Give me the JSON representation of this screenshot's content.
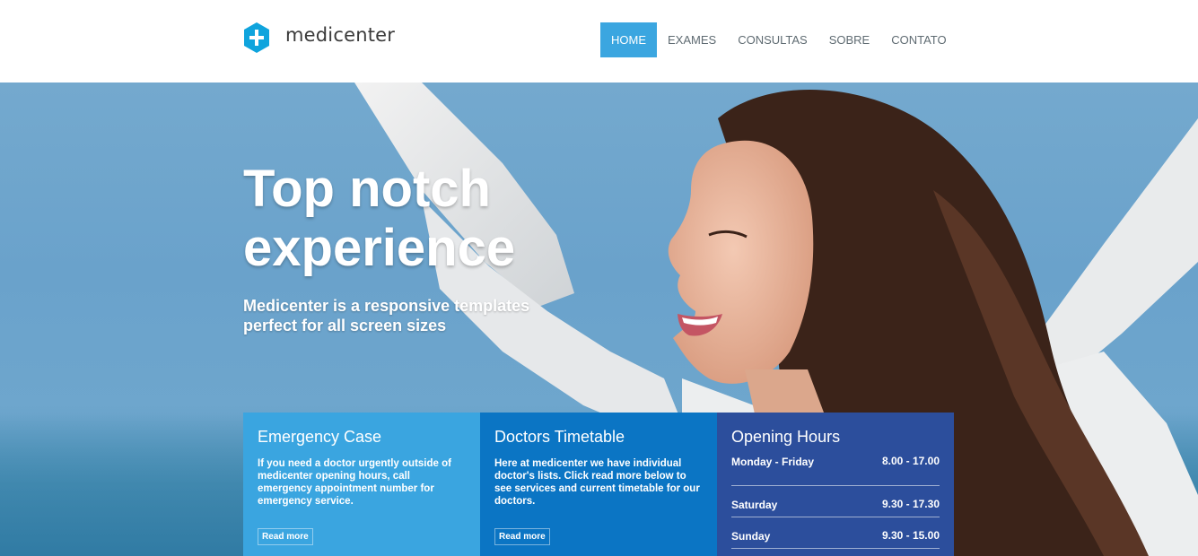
{
  "brand": {
    "name": "medicenter",
    "color": "#0fa4dd"
  },
  "nav": {
    "items": [
      {
        "label": "HOME",
        "active": true
      },
      {
        "label": "EXAMES",
        "active": false
      },
      {
        "label": "CONSULTAS",
        "active": false
      },
      {
        "label": "SOBRE",
        "active": false
      },
      {
        "label": "CONTATO",
        "active": false
      }
    ]
  },
  "hero": {
    "title_line1": "Top notch",
    "title_line2": "experience",
    "subtitle_line1": "Medicenter is a responsive templates",
    "subtitle_line2": "perfect for all screen sizes"
  },
  "boxes": {
    "emergency": {
      "title": "Emergency Case",
      "text": "If you need a doctor urgently outside of medicenter opening hours, call emergency appointment number for emergency service.",
      "button": "Read more",
      "color": "#3aa5e0"
    },
    "timetable": {
      "title": "Doctors Timetable",
      "text": "Here at medicenter we have individual doctor's lists. Click read more below to see services and current timetable for our doctors.",
      "button": "Read more",
      "color": "#0b75c4"
    },
    "hours": {
      "title": "Opening Hours",
      "color": "#2c4e9c",
      "rows": [
        {
          "day": "Monday - Friday",
          "time": "8.00 - 17.00"
        },
        {
          "day": "Saturday",
          "time": "9.30 - 17.30"
        },
        {
          "day": "Sunday",
          "time": "9.30 - 15.00"
        }
      ]
    }
  }
}
